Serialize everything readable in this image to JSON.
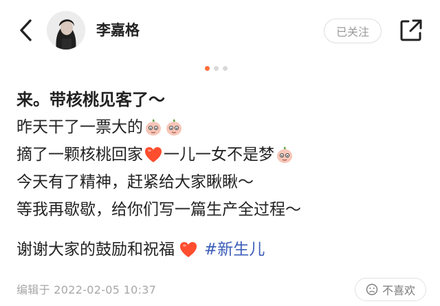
{
  "header": {
    "back_icon": "chevron-left-icon",
    "username": "李嘉格",
    "follow_label": "已关注",
    "share_icon": "share-arrow-icon"
  },
  "carousel": {
    "count": 3,
    "active_index": 0,
    "active_color": "#ff6d3a"
  },
  "post": {
    "title": "来。带核桃见客了～",
    "line1": "昨天干了一票大的",
    "line2a": "摘了一颗核桃回家",
    "line2b": "一儿一女不是梦",
    "line3": "今天有了精神，赶紧给大家瞅瞅～",
    "line4": "等我再歇歇，给你们写一篇生产全过程～",
    "line5": "谢谢大家的鼓励和祝福",
    "hashtag": "#新生儿",
    "hashtag_color": "#3c5eb8"
  },
  "footer": {
    "edited": "编辑于  2022-02-05 10:37",
    "dislike_label": "不喜欢",
    "dislike_icon": "frown-face-icon"
  }
}
